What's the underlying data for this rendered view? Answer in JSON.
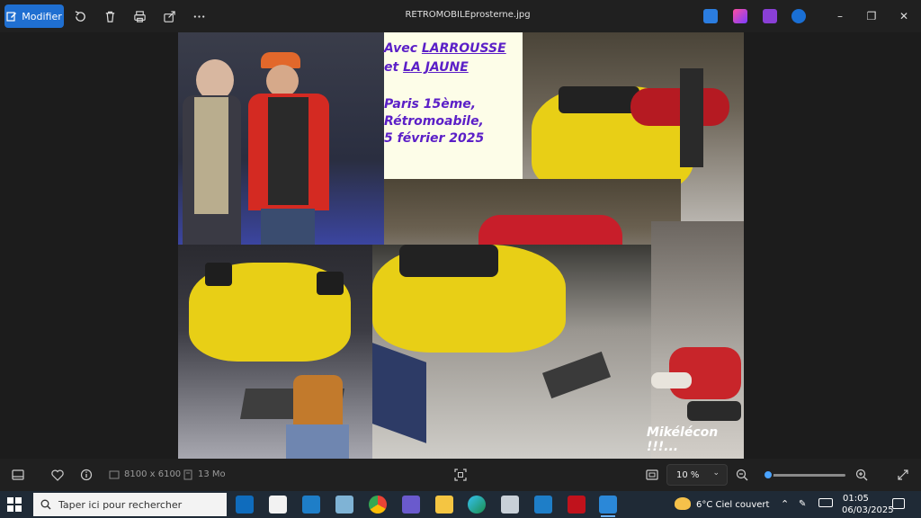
{
  "toolbar": {
    "edit_label": "Modifier",
    "filename": "RETROMOBILEprosterne.jpg"
  },
  "photo": {
    "caption_line1_prefix": "Avec ",
    "caption_line1_name": "LARROUSSE",
    "caption_line2_prefix": "et ",
    "caption_line2_name": "LA JAUNE",
    "caption_line3": "Paris 15ème,",
    "caption_line4": "Rétromoabile,",
    "caption_line5": "5 février 2025",
    "signature": "Mikélécon !!!..."
  },
  "statusbar": {
    "dimensions": "8100 x 6100",
    "filesize": "13 Mo",
    "zoom": "10 %",
    "zoom_level": 0.03
  },
  "taskbar": {
    "search_placeholder": "Taper ici pour rechercher",
    "weather": "6°C  Ciel couvert",
    "time": "01:05",
    "date": "06/03/2025"
  },
  "colors": {
    "accent": "#1f6fd1",
    "caption_text": "#5b1fc7",
    "car_yellow": "#e8cf16",
    "car_red": "#c81e2a"
  }
}
